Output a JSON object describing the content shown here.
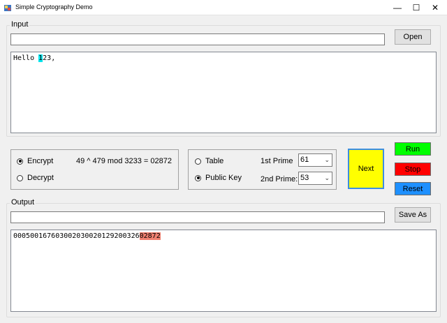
{
  "window": {
    "title": "Simple Cryptography Demo",
    "minimize_glyph": "—",
    "maximize_glyph": "☐",
    "close_glyph": "✕"
  },
  "input_group": {
    "label": "Input",
    "file_path": "",
    "open_label": "Open",
    "text_before": "Hello ",
    "text_highlight": "1",
    "text_after": "23,"
  },
  "mode": {
    "encrypt_label": "Encrypt",
    "decrypt_label": "Decrypt",
    "selected": "Encrypt",
    "formula": "49 ^ 479 mod 3233 = 02872"
  },
  "key_panel": {
    "table_label": "Table",
    "public_key_label": "Public Key",
    "selected": "Public Key",
    "prime1_label": "1st Prime",
    "prime1_value": "61",
    "prime2_label": "2nd Prime:",
    "prime2_value": "53"
  },
  "controls": {
    "next_label": "Next",
    "run_label": "Run",
    "stop_label": "Stop",
    "reset_label": "Reset"
  },
  "output_group": {
    "label": "Output",
    "file_path": "",
    "save_label": "Save As",
    "text_plain": "00050016760300203002012920032 6",
    "text_main": "000500167603002030020129200326",
    "text_highlight": "02872"
  },
  "colors": {
    "run": "#00ff00",
    "stop": "#ff0000",
    "reset": "#1e90ff",
    "next": "#ffff00",
    "input_highlight": "#00e5ee",
    "output_highlight": "#f08070"
  },
  "icons": {
    "app": "app-icon",
    "dropdown": "chevron-down-icon"
  }
}
